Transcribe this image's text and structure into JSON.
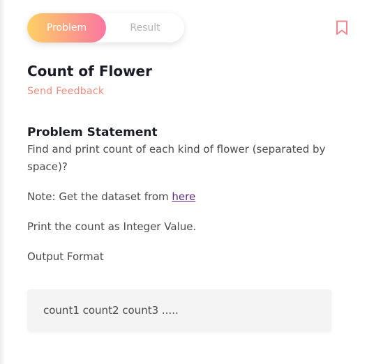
{
  "tabs": {
    "problem_label": "Problem",
    "result_label": "Result"
  },
  "bookmark": {
    "icon": "bookmark-icon",
    "color": "#f3868f"
  },
  "problem": {
    "title": "Count of Flower",
    "feedback_label": "Send Feedback",
    "statement_heading": "Problem Statement",
    "description": "Find and print count of each kind of flower (separated by space)?",
    "note_prefix": "Note: Get the dataset from ",
    "note_link": "here",
    "print_instruction": "Print the count as Integer Value.",
    "output_format_label": "Output Format",
    "output_format_example": "count1 count2 count3 ....."
  },
  "colors": {
    "accent_gradient_start": "#fdd164",
    "accent_gradient_end": "#fb76a0",
    "feedback": "#f38b7c",
    "link": "#5b2a86"
  }
}
